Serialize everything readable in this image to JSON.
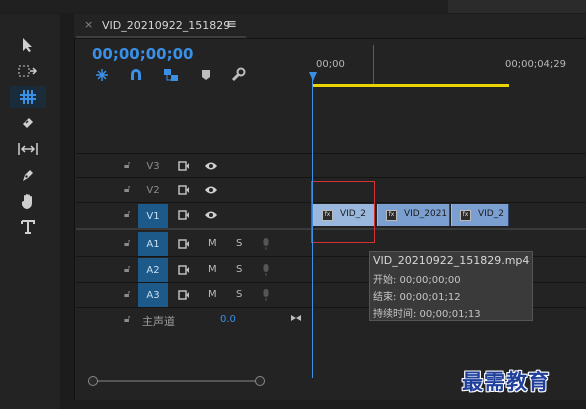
{
  "sequence": {
    "tab_title": "VID_20210922_151829",
    "close_glyph": "×",
    "menu_glyph": "≡",
    "timecode": "00;00;00;00"
  },
  "ruler": {
    "start_label": "00;00",
    "end_label": "00;00;04;29"
  },
  "tracks": {
    "video": [
      {
        "label": "V3",
        "targeted": false
      },
      {
        "label": "V2",
        "targeted": false
      },
      {
        "label": "V1",
        "targeted": true
      }
    ],
    "audio": [
      {
        "label": "A1",
        "mute": "M",
        "solo": "S"
      },
      {
        "label": "A2",
        "mute": "M",
        "solo": "S"
      },
      {
        "label": "A3",
        "mute": "M",
        "solo": "S"
      }
    ],
    "master": {
      "label": "主声道",
      "value": "0.0"
    }
  },
  "clips": [
    {
      "label": "VID_2"
    },
    {
      "label": "VID_2021"
    },
    {
      "label": "VID_2"
    }
  ],
  "tooltip": {
    "filename": "VID_20210922_151829.mp4",
    "start": "开始: 00;00;00;00",
    "end": "结束: 00;00;01;12",
    "duration": "持续时间: 00;00;01;13"
  },
  "watermark": "最需教育",
  "colors": {
    "accent": "#3a8fe6",
    "work_area": "#e8d400",
    "clip": "#7a9fd0",
    "selection": "#d23434",
    "track_target": "#1d5a8a"
  },
  "tools": [
    "selection-tool-icon",
    "track-select-icon",
    "ripple-edit-icon",
    "razor-icon",
    "slip-icon",
    "pen-icon",
    "hand-icon",
    "type-icon"
  ]
}
